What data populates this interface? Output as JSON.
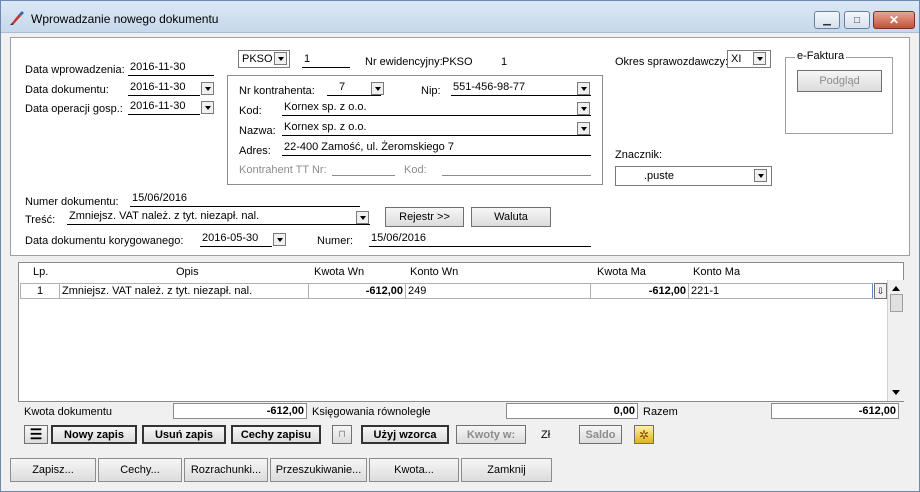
{
  "window": {
    "title": "Wprowadzanie nowego dokumentu",
    "minimize": "▁",
    "maximize": "□",
    "close": "✕"
  },
  "header": {
    "data_wprowadzenia_label": "Data wprowadzenia:",
    "data_wprowadzenia_value": "2016-11-30",
    "data_dokumentu_label": "Data dokumentu:",
    "data_dokumentu_value": "2016-11-30",
    "data_operacji_label": "Data operacji gosp.:",
    "data_operacji_value": "2016-11-30",
    "rejestr_value": "PKSO",
    "rejestr_num": "1",
    "nr_ewid_label": "Nr ewidencyjny:",
    "nr_ewid_rejestr": "PKSO",
    "nr_ewid_value": "1",
    "okres_label": "Okres sprawozdawczy:",
    "okres_value": "XI",
    "efaktura_label": "e-Faktura",
    "podglad_label": "Podgląd",
    "znacznik_label": "Znacznik:",
    "znacznik_value": ".puste"
  },
  "kontrahent": {
    "nr_label": "Nr kontrahenta:",
    "nr_value": "7",
    "nip_label": "Nip:",
    "nip_value": "551-456-98-77",
    "kod_label": "Kod:",
    "kod_value": "Kornex sp. z o.o.",
    "nazwa_label": "Nazwa:",
    "nazwa_value": "Kornex sp. z o.o.",
    "adres_label": "Adres:",
    "adres_value": "22-400 Zamość, ul. Żeromskiego 7",
    "tt_label": "Kontrahent TT Nr:",
    "tt_kod_label": "Kod:"
  },
  "document": {
    "numer_label": "Numer dokumentu:",
    "numer_value": "15/06/2016",
    "tresc_label": "Treść:",
    "tresc_value": "Zmniejsz. VAT należ. z tyt. niezapł. nal.",
    "rejestr_btn": "Rejestr >>",
    "waluta_btn": "Waluta",
    "data_kor_label": "Data dokumentu korygowanego:",
    "data_kor_value": "2016-05-30",
    "numer2_label": "Numer:",
    "numer2_value": "15/06/2016"
  },
  "grid": {
    "columns": [
      "Lp.",
      "Opis",
      "Kwota  Wn",
      "Konto  Wn",
      "Kwota Ma",
      "Konto Ma"
    ],
    "rows": [
      {
        "lp": "1",
        "opis": "Zmniejsz. VAT należ. z tyt. niezapł. nal.",
        "kwota_wn": "-612,00",
        "konto_wn": "249",
        "kwota_ma": "-612,00",
        "konto_ma": "221-1"
      }
    ]
  },
  "summary": {
    "kwota_label": "Kwota dokumentu",
    "kwota_value": "-612,00",
    "ksieg_label": "Księgowania równoległe",
    "ksieg_value": "0,00",
    "razem_label": "Razem",
    "razem_value": "-612,00"
  },
  "toolbar": {
    "nowy": "Nowy zapis",
    "usun": "Usuń zapis",
    "cechy_zapisu": "Cechy zapisu",
    "uzyj": "Użyj wzorca",
    "kwoty": "Kwoty w:",
    "currency": "Zł",
    "saldo": "Saldo"
  },
  "bottom_tabs": [
    "Zapisz...",
    "Cechy...",
    "Rozrachunki...",
    "Przeszukiwanie...",
    "Kwota...",
    "Zamknij"
  ]
}
